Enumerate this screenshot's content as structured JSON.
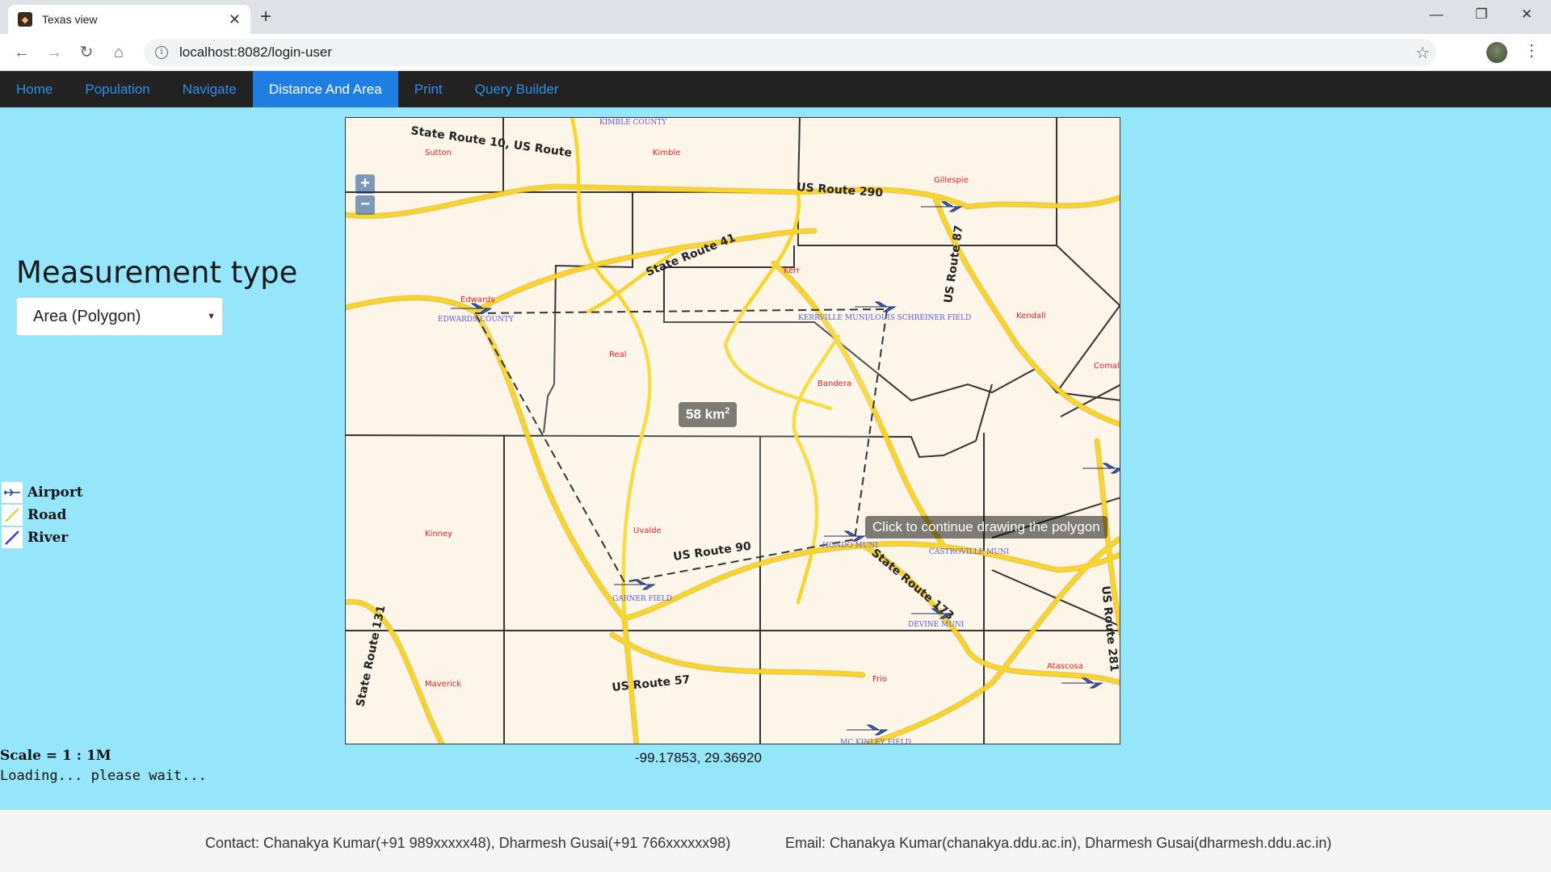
{
  "browser": {
    "tab_title": "Texas view",
    "new_tab": "+",
    "url": "localhost:8082/login-user"
  },
  "nav": {
    "items": [
      "Home",
      "Population",
      "Navigate",
      "Distance And Area",
      "Print",
      "Query Builder"
    ],
    "active": "Distance And Area"
  },
  "measurement": {
    "title": "Measurement type",
    "selected": "Area (Polygon)"
  },
  "legend": {
    "items": [
      {
        "label": "Airport",
        "icon": "airplane-icon"
      },
      {
        "label": "Road",
        "icon": "road-line-icon",
        "color": "#f2c94c"
      },
      {
        "label": "River",
        "icon": "river-line-icon",
        "color": "#3a3ad8"
      }
    ]
  },
  "scale_text": "Scale = 1 : 1M",
  "loading_text": "Loading... please wait...",
  "map": {
    "zoom_in": "+",
    "zoom_out": "−",
    "measure_value": "58 km",
    "measure_unit_sup": "2",
    "help_text": "Click to continue drawing the polygon",
    "coordinates": "-99.17853, 29.36920",
    "road_labels": [
      "State Route 10, US Route",
      "US Route 290",
      "State Route 41",
      "US Route 87",
      "US Route 90",
      "State Route 173",
      "US Route 57",
      "State Route 131",
      "US Route 281"
    ],
    "county_labels": [
      "Sutton",
      "Kimble",
      "Gillespie",
      "Kerr",
      "Edwards",
      "Real",
      "Kendall",
      "Bandera",
      "Comal",
      "Kinney",
      "Uvalde",
      "Maverick",
      "Atascosa",
      "Frio"
    ],
    "airport_labels": [
      "KIMBLE COUNTY",
      "EDWARDS COUNTY",
      "KERRVILLE MUNI/LOUIS SCHREINER FIELD",
      "GARNER FIELD",
      "HONDO MUNI",
      "CASTROVILLE MUNI",
      "DEVINE MUNI",
      "MC KINLEY FIELD"
    ],
    "colors": {
      "road": "#f2c218",
      "background": "#fdf5e8",
      "county_line": "#333333"
    }
  },
  "footer": {
    "contact": "Contact: Chanakya Kumar(+91 989xxxxx48), Dharmesh Gusai(+91 766xxxxxx98)",
    "email": "Email: Chanakya Kumar(chanakya.ddu.ac.in), Dharmesh Gusai(dharmesh.ddu.ac.in)"
  }
}
